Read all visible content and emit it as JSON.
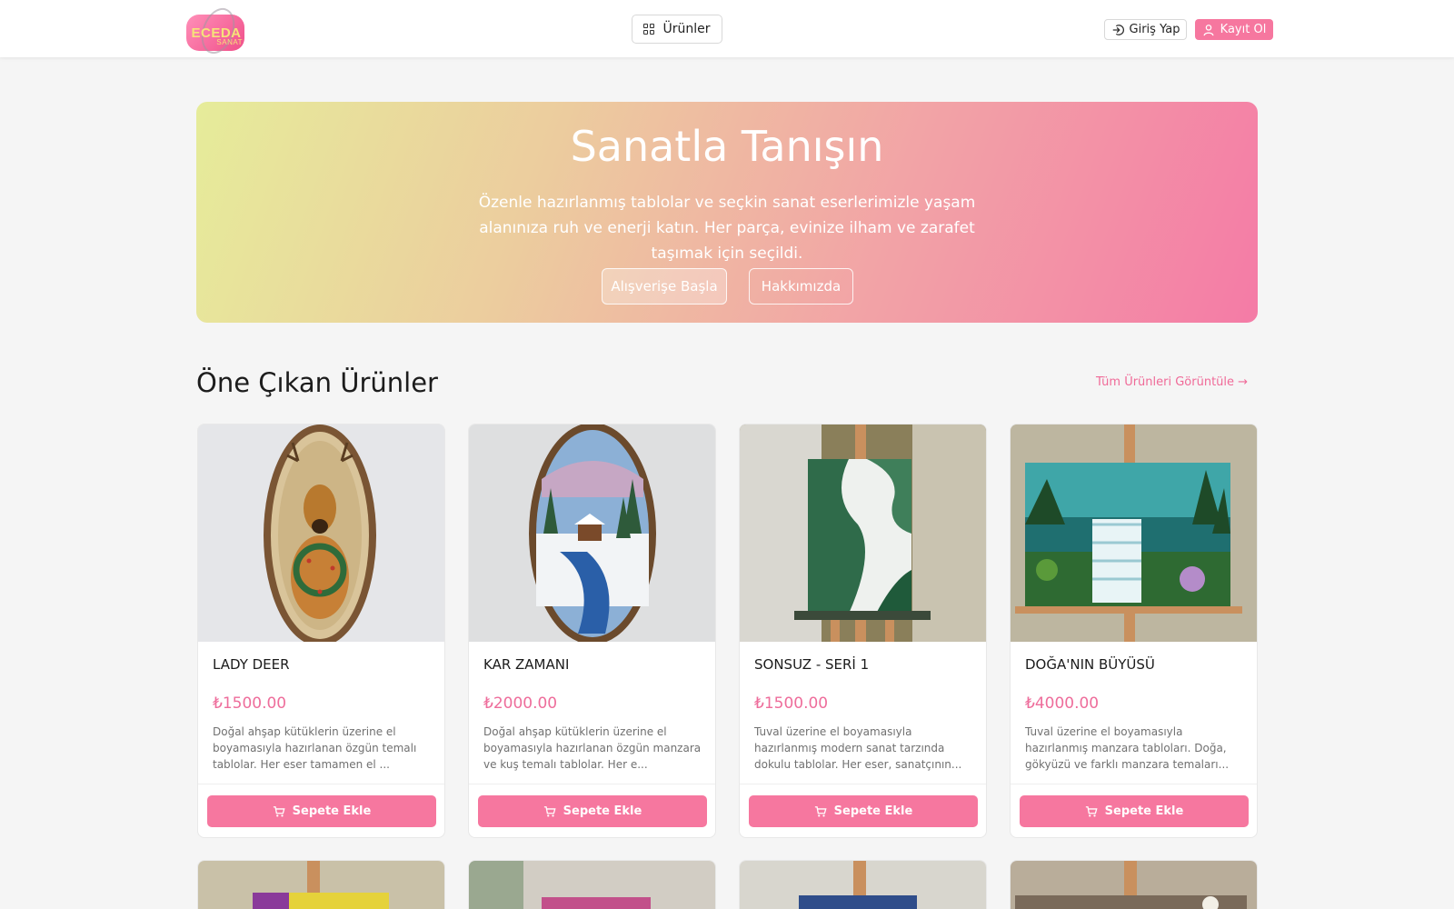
{
  "header": {
    "logo_text": "ECEDA",
    "logo_subtext": "SANAT",
    "products_label": "Ürünler",
    "login_label": "Giriş Yap",
    "register_label": "Kayıt Ol"
  },
  "hero": {
    "title": "Sanatla Tanışın",
    "subtitle": "Özenle hazırlanmış tablolar ve seçkin sanat eserlerimizle yaşam alanınıza ruh ve enerji katın. Her parça, evinize ilham ve zarafet taşımak için seçildi.",
    "shop_button": "Alışverişe Başla",
    "about_button": "Hakkımızda"
  },
  "featured": {
    "title": "Öne Çıkan Ürünler",
    "view_all": "Tüm Ürünleri Görüntüle →",
    "products": [
      {
        "name": "LADY DEER",
        "price": "₺1500.00",
        "description": "Doğal ahşap kütüklerin üzerine el boyamasıyla hazırlanan özgün temalı tablolar. Her eser tamamen el ...",
        "button": "Sepete Ekle"
      },
      {
        "name": "KAR ZAMANI",
        "price": "₺2000.00",
        "description": "Doğal ahşap kütüklerin üzerine el boyamasıyla hazırlanan özgün manzara ve kuş temalı tablolar. Her e...",
        "button": "Sepete Ekle"
      },
      {
        "name": "SONSUZ - SERİ 1",
        "price": "₺1500.00",
        "description": "Tuval üzerine el boyamasıyla hazırlanmış modern sanat tarzında dokulu tablolar. Her eser, sanatçının...",
        "button": "Sepete Ekle"
      },
      {
        "name": "DOĞA'NIN BÜYÜSÜ",
        "price": "₺4000.00",
        "description": "Tuval üzerine el boyamasıyla hazırlanmış manzara tabloları. Doğa, gökyüzü ve farklı manzara temaları...",
        "button": "Sepete Ekle"
      }
    ]
  },
  "colors": {
    "accent": "#f6779f",
    "price": "#ee6d9b",
    "hero_gradient_start": "#e6ec9a",
    "hero_gradient_end": "#f47ba6"
  },
  "icons": [
    "grid-icon",
    "login-icon",
    "user-icon",
    "cart-icon"
  ]
}
